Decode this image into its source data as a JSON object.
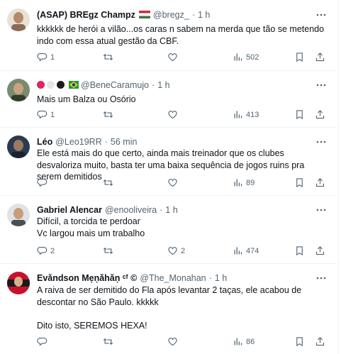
{
  "tweets": [
    {
      "name": "(ASAP) BREgz Champz",
      "handle": "@bregz_",
      "dot": "·",
      "time": "1 h",
      "text": "kkkkkk de herói a vilão...os caras n sabem na merda que tão se metendo\nindo com essa atual gestão da CBF.",
      "replies": "1",
      "retweets": "",
      "likes": "",
      "views": "502"
    },
    {
      "name": "",
      "handle": "@BeneCaramujo",
      "dot": "·",
      "time": "1 h",
      "text": "Mais um Balza ou Osório",
      "replies": "1",
      "retweets": "",
      "likes": "",
      "views": "413"
    },
    {
      "name": "Léo",
      "handle": "@Leo19RR",
      "dot": "·",
      "time": "56 min",
      "text": "Ele está mais do que certo, ainda mais treinador que os clubes desvaloriza muito, basta ter uma baixa sequência de jogos ruins pra serem demitidos",
      "replies": "",
      "retweets": "",
      "likes": "",
      "views": "89"
    },
    {
      "name": "Gabriel Alencar",
      "handle": "@enooliveira",
      "dot": "·",
      "time": "1 h",
      "text": "Difícil, a torcida te perdoar\nVc largou mais um trabalho",
      "replies": "2",
      "retweets": "",
      "likes": "2",
      "views": "474"
    },
    {
      "name": "Evǎndson Mẹṇǎhǎṇ ᶜᶠ ©",
      "handle": "@The_Monahan",
      "dot": "·",
      "time": "1 h",
      "text": "A raiva de ser demitido do Fla após levantar 2 taças, ele acabou de descontar no São Paulo. kkkkk\n\nDito isto, SEREMOS HEXA!",
      "replies": "",
      "retweets": "",
      "likes": "",
      "views": "86"
    }
  ],
  "icons": {
    "more": "more-dots-icon",
    "reply": "reply-icon",
    "retweet": "retweet-icon",
    "like": "heart-icon",
    "views": "views-icon",
    "bookmark": "bookmark-icon",
    "share": "share-icon"
  },
  "colors": {
    "text": "#0f1419",
    "muted": "#536471",
    "border": "#eff3f4"
  }
}
